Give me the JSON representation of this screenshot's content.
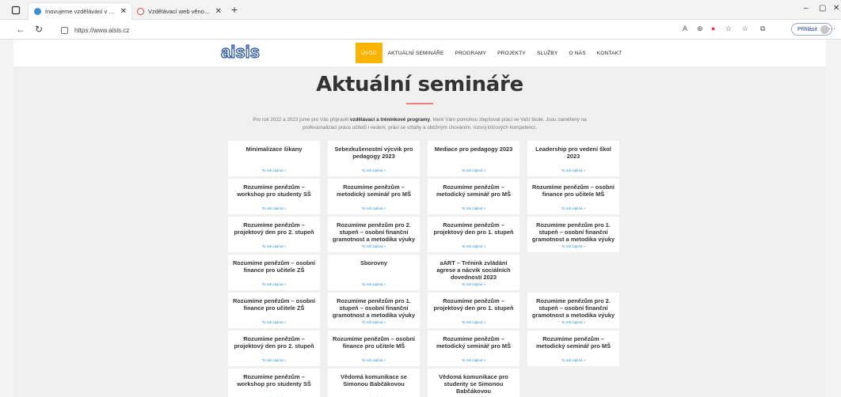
{
  "browser": {
    "tabs": [
      {
        "title": "Inovujeme vzdělávání v České re",
        "active": true,
        "favicon_color": "#3f8ed8"
      },
      {
        "title": "Vzdělávací web věnovaný financ",
        "active": false,
        "favicon_color": "#e53935"
      }
    ],
    "new_tab_label": "+",
    "url": "https://www.aisis.cz",
    "signin_label": "Přihlásit",
    "controls": {
      "minimize": "–",
      "restore": "▢",
      "close": "✕"
    }
  },
  "site": {
    "logo_text": "aisis",
    "logo_color": "#1f4f9a",
    "menu": [
      "ÚVOD",
      "AKTUÁLNÍ SEMINÁŘE",
      "PROGRAMY",
      "PROJEKTY",
      "SLUŽBY",
      "O NÁS",
      "KONTAKT"
    ],
    "menu_active_color": "#f9b300",
    "title": "Aktuální semináře",
    "intro": {
      "before": "Pro rok 2022 a 2023 jsme pro Vás připravili ",
      "bold": "vzdělávací a tréninkové programy",
      "after": ", které Vám pomohou zlepšovat práci ve Vaší škole. Jsou zaměřeny na profesionalizaci práce učitelů i vedení, práci se vztahy a  obtížným chováním, rozvoj klíčových kompetencí."
    },
    "link_label": "To mě zajímá »",
    "cards": [
      "Minimalizace šikany",
      "Sebezkušenostní výcvik pro pedagogy 2023",
      "Mediace pro pedagogy 2023",
      "Leadership pro vedení škol 2023",
      "Rozumíme penězům – workshop pro studenty SŠ",
      "Rozumíme penězům – metodický seminář pro MŠ",
      "Rozumíme penězům – metodický seminář pro MŠ",
      "Rozumíme penězům – osobní finance pro učitele MŠ",
      "Rozumíme penězům – projektový den pro 2. stupeň",
      "Rozumíme penězům pro 2. stupeň – osobní finanční gramotnost a metodika výuky",
      "Rozumíme penězům – projektový den pro 1. stupeň",
      "Rozumíme penězům pro 1. stupeň – osobní finanční gramotnost a metodika výuky",
      "Rozumíme penězům – osobní finance pro učitele ZŠ",
      "Sborovny",
      "aART – Trénink zvládání agrese a nácvik sociálních dovedností 2023",
      "",
      "Rozumíme penězům – osobní finance pro učitele ZŠ",
      "Rozumíme penězům pro 1. stupeň – osobní finanční gramotnost a metodika výuky",
      "Rozumíme penězům – projektový den pro 1. stupeň",
      "Rozumíme penězům pro 2. stupeň – osobní finanční gramotnost a metodika výuky",
      "Rozumíme penězům – projektový den pro 2. stupeň",
      "Rozumíme penězům – osobní finance pro učitele MŠ",
      "Rozumíme penězům – metodický seminář pro MŠ",
      "Rozumíme penězům – metodický seminář pro MŠ",
      "Rozumíme penězům – workshop pro studenty SŠ",
      "Vědomá komunikace se Simonou Babčákovou",
      "Vědomá komunikace pro studenty se Simonou Babčákovou",
      ""
    ]
  }
}
